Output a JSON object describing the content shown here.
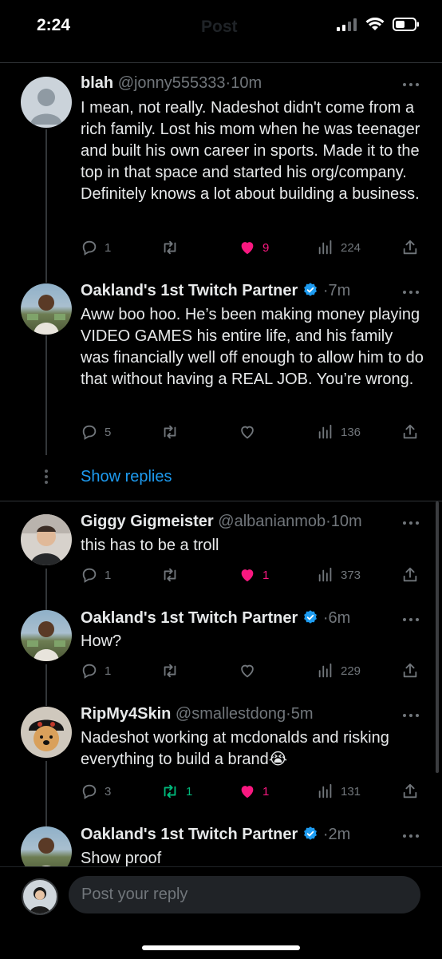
{
  "status_bar": {
    "time": "2:24"
  },
  "header": {
    "title": "Post"
  },
  "tweets": [
    {
      "name": "blah",
      "handle": "@jonny555333",
      "time": "10m",
      "text": "I mean, not really. Nadeshot didn't come from a rich family. Lost his mom when he was teenager and built his own career in sports. Made it to the top in that space and started his org/company. Definitely knows a lot about building a business.",
      "replies": "1",
      "reposts": "",
      "likes": "9",
      "views": "224",
      "liked": true,
      "reposted": false
    },
    {
      "name": "Oakland's 1st Twitch Partner",
      "verified": true,
      "time": "7m",
      "text": "Aww boo hoo. He’s been making money playing VIDEO GAMES his entire life, and his family was financially well off enough to allow him to do that without having a REAL JOB. You’re wrong.",
      "replies": "5",
      "reposts": "",
      "likes": "",
      "views": "136",
      "liked": false,
      "reposted": false
    },
    {
      "name": "Giggy Gigmeister",
      "handle": "@albanianmob",
      "time": "10m",
      "text": "this has to be a troll",
      "replies": "1",
      "reposts": "",
      "likes": "1",
      "views": "373",
      "liked": true,
      "reposted": false
    },
    {
      "name": "Oakland's 1st Twitch Partner",
      "verified": true,
      "time": "6m",
      "text": "How?",
      "replies": "1",
      "reposts": "",
      "likes": "",
      "views": "229",
      "liked": false,
      "reposted": false
    },
    {
      "name": "RipMy4Skin",
      "handle": "@smallestdong",
      "time": "5m",
      "text": "Nadeshot working at mcdonalds and risking everything to build a brand😭",
      "replies": "3",
      "reposts": "1",
      "likes": "1",
      "views": "131",
      "liked": true,
      "reposted": true
    },
    {
      "name": "Oakland's 1st Twitch Partner",
      "verified": true,
      "time": "2m",
      "text": "Show proof"
    }
  ],
  "show_replies_label": "Show replies",
  "reply_box": {
    "placeholder": "Post your reply"
  },
  "colors": {
    "like": "#f91880",
    "repost": "#00ba7c",
    "link": "#1d9bf0",
    "verified": "#1d9bf0"
  },
  "icons": [
    "reply-icon",
    "repost-icon",
    "heart-icon",
    "views-icon",
    "share-icon",
    "more-icon",
    "verified-icon"
  ]
}
